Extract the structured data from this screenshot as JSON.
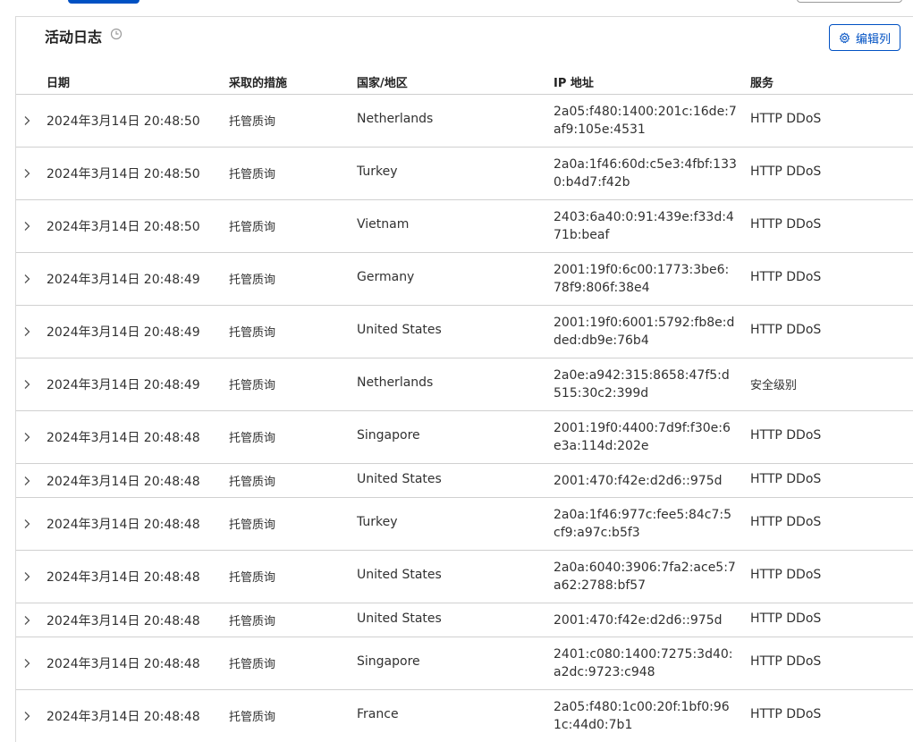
{
  "card": {
    "title": "活动日志",
    "edit_columns_label": "编辑列"
  },
  "columns": {
    "date": "日期",
    "action": "采取的措施",
    "country": "国家/地区",
    "ip": "IP 地址",
    "service": "服务"
  },
  "rows": [
    {
      "date": "2024年3月14日 20:48:50",
      "action": "托管质询",
      "country": "Netherlands",
      "ip": "2a05:f480:1400:201c:16de:7af9:105e:4531",
      "service": "HTTP DDoS"
    },
    {
      "date": "2024年3月14日 20:48:50",
      "action": "托管质询",
      "country": "Turkey",
      "ip": "2a0a:1f46:60d:c5e3:4fbf:1330:b4d7:f42b",
      "service": "HTTP DDoS"
    },
    {
      "date": "2024年3月14日 20:48:50",
      "action": "托管质询",
      "country": "Vietnam",
      "ip": "2403:6a40:0:91:439e:f33d:471b:beaf",
      "service": "HTTP DDoS"
    },
    {
      "date": "2024年3月14日 20:48:49",
      "action": "托管质询",
      "country": "Germany",
      "ip": "2001:19f0:6c00:1773:3be6:78f9:806f:38e4",
      "service": "HTTP DDoS"
    },
    {
      "date": "2024年3月14日 20:48:49",
      "action": "托管质询",
      "country": "United States",
      "ip": "2001:19f0:6001:5792:fb8e:dded:db9e:76b4",
      "service": "HTTP DDoS"
    },
    {
      "date": "2024年3月14日 20:48:49",
      "action": "托管质询",
      "country": "Netherlands",
      "ip": "2a0e:a942:315:8658:47f5:d515:30c2:399d",
      "service": "安全级别"
    },
    {
      "date": "2024年3月14日 20:48:48",
      "action": "托管质询",
      "country": "Singapore",
      "ip": "2001:19f0:4400:7d9f:f30e:6e3a:114d:202e",
      "service": "HTTP DDoS"
    },
    {
      "date": "2024年3月14日 20:48:48",
      "action": "托管质询",
      "country": "United States",
      "ip": "2001:470:f42e:d2d6::975d",
      "service": "HTTP DDoS"
    },
    {
      "date": "2024年3月14日 20:48:48",
      "action": "托管质询",
      "country": "Turkey",
      "ip": "2a0a:1f46:977c:fee5:84c7:5cf9:a97c:b5f3",
      "service": "HTTP DDoS"
    },
    {
      "date": "2024年3月14日 20:48:48",
      "action": "托管质询",
      "country": "United States",
      "ip": "2a0a:6040:3906:7fa2:ace5:7a62:2788:bf57",
      "service": "HTTP DDoS"
    },
    {
      "date": "2024年3月14日 20:48:48",
      "action": "托管质询",
      "country": "United States",
      "ip": "2001:470:f42e:d2d6::975d",
      "service": "HTTP DDoS"
    },
    {
      "date": "2024年3月14日 20:48:48",
      "action": "托管质询",
      "country": "Singapore",
      "ip": "2401:c080:1400:7275:3d40:a2dc:9723:c948",
      "service": "HTTP DDoS"
    },
    {
      "date": "2024年3月14日 20:48:48",
      "action": "托管质询",
      "country": "France",
      "ip": "2a05:f480:1c00:20f:1bf0:961c:44d0:7b1",
      "service": "HTTP DDoS"
    }
  ],
  "colors": {
    "accent": "#0051c3",
    "text": "#313131",
    "border": "#d0d0d0"
  },
  "icons": {
    "title": "clock-icon",
    "edit": "gear-icon",
    "row_expand": "chevron-right-icon"
  }
}
